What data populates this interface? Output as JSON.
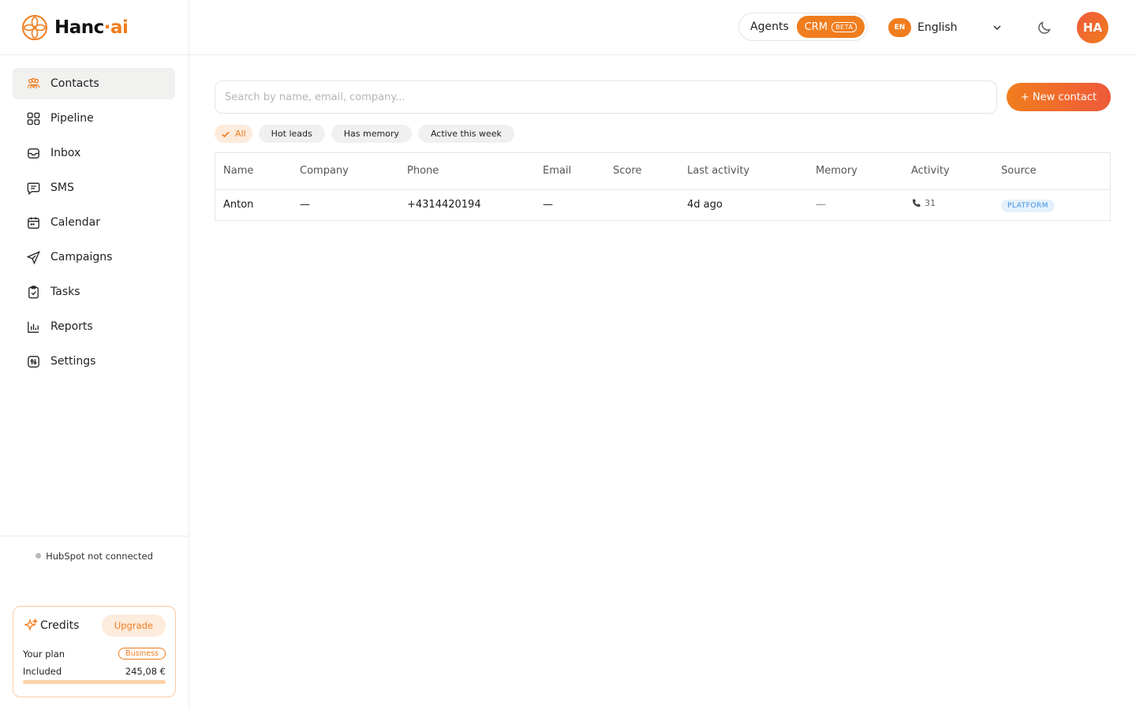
{
  "brand": {
    "name_part1": "Hanc",
    "name_dot": "·",
    "name_part2": "ai"
  },
  "sidebar": {
    "items": [
      {
        "label": "Contacts",
        "icon": "contacts-icon",
        "active": true
      },
      {
        "label": "Pipeline",
        "icon": "pipeline-icon"
      },
      {
        "label": "Inbox",
        "icon": "inbox-icon"
      },
      {
        "label": "SMS",
        "icon": "sms-icon"
      },
      {
        "label": "Calendar",
        "icon": "calendar-icon"
      },
      {
        "label": "Campaigns",
        "icon": "campaigns-icon"
      },
      {
        "label": "Tasks",
        "icon": "tasks-icon"
      },
      {
        "label": "Reports",
        "icon": "reports-icon"
      },
      {
        "label": "Settings",
        "icon": "settings-icon"
      }
    ],
    "hubspot_status": "HubSpot not connected",
    "credits": {
      "title": "Credits",
      "upgrade_label": "Upgrade",
      "plan_label": "Your plan",
      "plan_value": "Business",
      "included_label": "Included",
      "included_value": "245,08 €",
      "usage_fraction": 1.0
    }
  },
  "header": {
    "mode_agents": "Agents",
    "mode_crm": "CRM",
    "mode_crm_badge": "BETA",
    "language_code": "EN",
    "language_name": "English",
    "avatar_initials": "HA"
  },
  "main": {
    "search_placeholder": "Search by name, email, company...",
    "new_contact_label": "+ New contact",
    "filters": [
      "All",
      "Hot leads",
      "Has memory",
      "Active this week"
    ],
    "active_filter": "All",
    "table": {
      "columns": [
        "Name",
        "Company",
        "Phone",
        "Email",
        "Score",
        "Last activity",
        "Memory",
        "Activity",
        "Source"
      ],
      "rows": [
        {
          "name": "Anton",
          "company": "—",
          "phone": "+4314420194",
          "email": "—",
          "score": "",
          "last_activity": "4d ago",
          "memory": "—",
          "activity_count": "31",
          "source": "PLATFORM"
        }
      ]
    }
  },
  "colors": {
    "accent": "#f07d1e",
    "accent_red": "#ef5a3a",
    "active_nav_bg": "#f1f1ef",
    "source_badge_bg": "#e4f1fd",
    "source_badge_text": "#3b8ee0"
  }
}
